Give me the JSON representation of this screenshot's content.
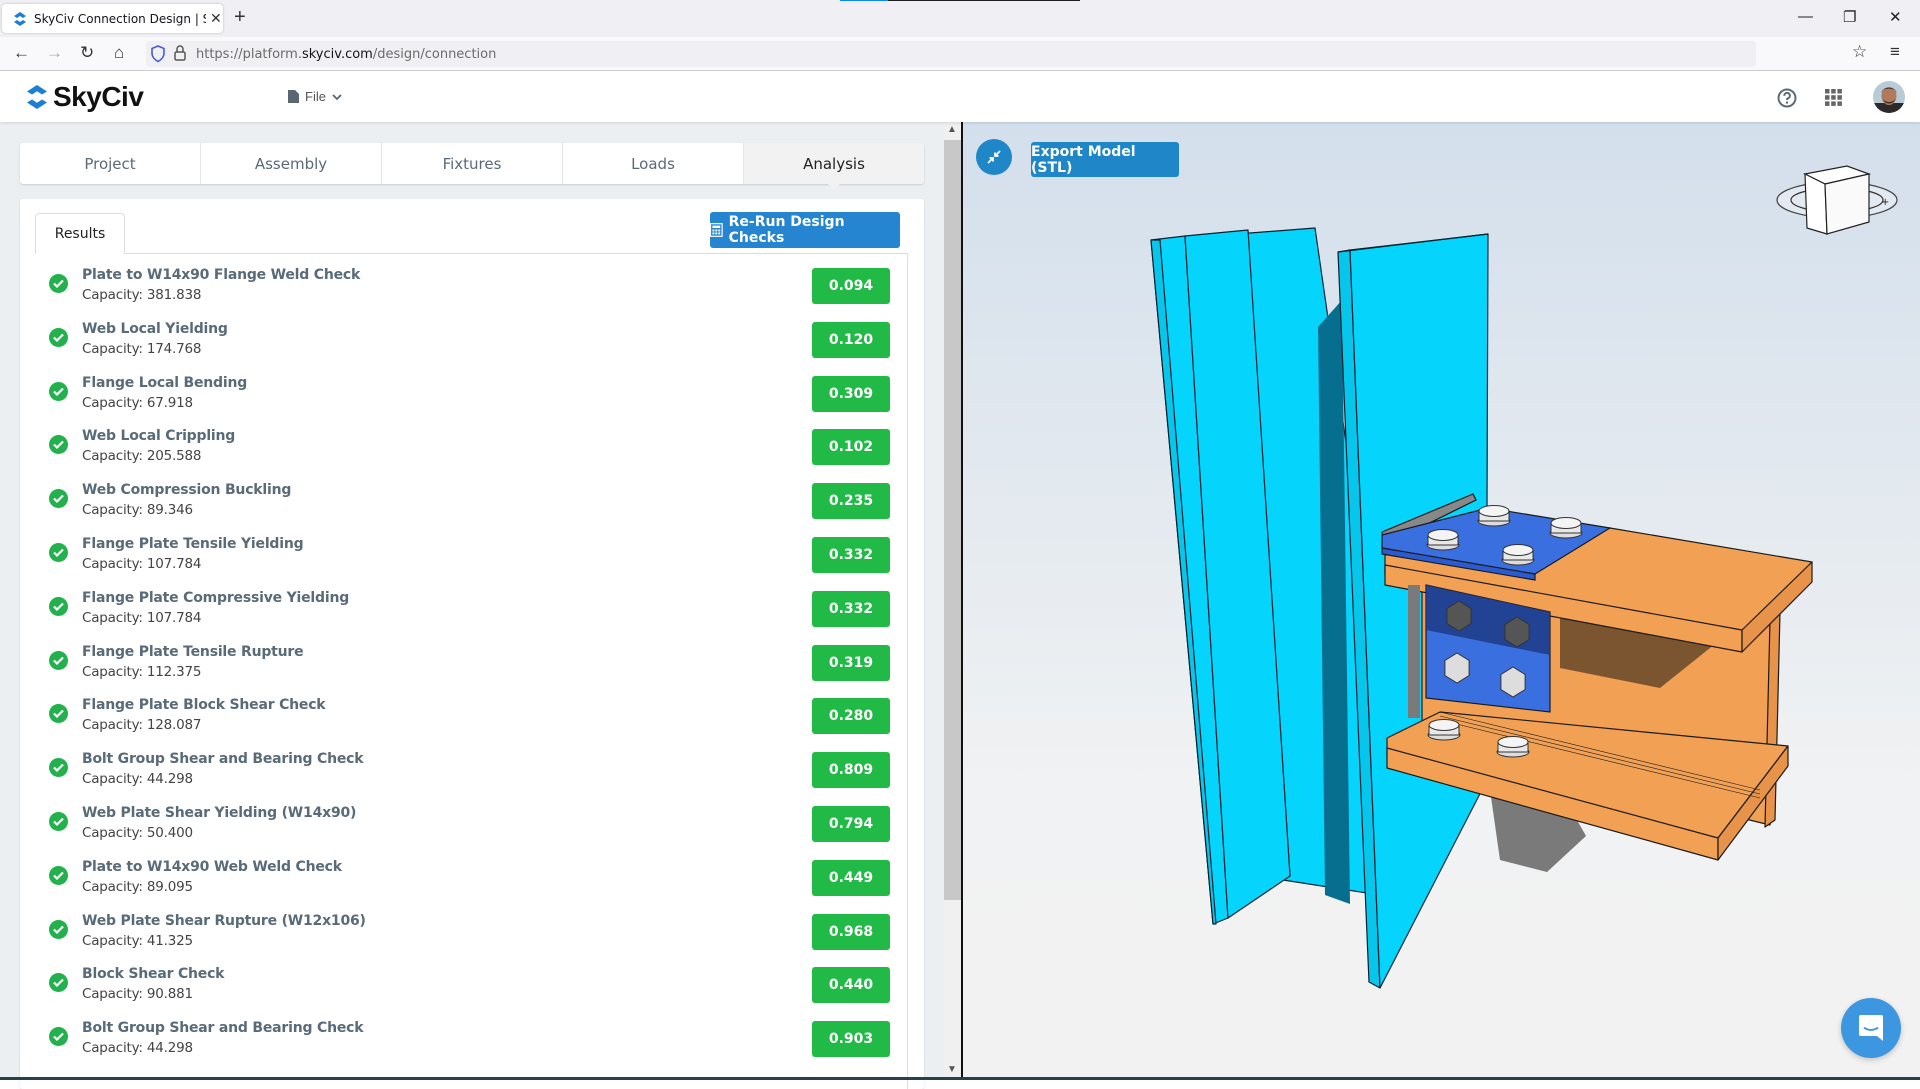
{
  "browser": {
    "tab_title": "SkyCiv Connection Design | SkyCiv",
    "new_tab": "+",
    "close_tab": "✕",
    "url_prefix": "https://platform.",
    "url_domain": "skyciv.com",
    "url_path": "/design/connection",
    "window_controls": {
      "minimize": "—",
      "restore": "❐",
      "close": "✕"
    }
  },
  "header": {
    "brand": "SkyCiv",
    "file_menu": "File",
    "icons": [
      "help-icon",
      "apps-grid-icon",
      "user-avatar"
    ]
  },
  "steps": [
    {
      "label": "Project",
      "active": false
    },
    {
      "label": "Assembly",
      "active": false
    },
    {
      "label": "Fixtures",
      "active": false
    },
    {
      "label": "Loads",
      "active": false
    },
    {
      "label": "Analysis",
      "active": true
    }
  ],
  "results_panel": {
    "tab_label": "Results",
    "rerun_label": "Re-Run Design Checks",
    "capacity_prefix": "Capacity: ",
    "checks": [
      {
        "title": "Plate to W14x90 Flange Weld Check",
        "capacity": "381.838",
        "ratio": "0.094",
        "status": "pass"
      },
      {
        "title": "Web Local Yielding",
        "capacity": "174.768",
        "ratio": "0.120",
        "status": "pass"
      },
      {
        "title": "Flange Local Bending",
        "capacity": "67.918",
        "ratio": "0.309",
        "status": "pass"
      },
      {
        "title": "Web Local Crippling",
        "capacity": "205.588",
        "ratio": "0.102",
        "status": "pass"
      },
      {
        "title": "Web Compression Buckling",
        "capacity": "89.346",
        "ratio": "0.235",
        "status": "pass"
      },
      {
        "title": "Flange Plate Tensile Yielding",
        "capacity": "107.784",
        "ratio": "0.332",
        "status": "pass"
      },
      {
        "title": "Flange Plate Compressive Yielding",
        "capacity": "107.784",
        "ratio": "0.332",
        "status": "pass"
      },
      {
        "title": "Flange Plate Tensile Rupture",
        "capacity": "112.375",
        "ratio": "0.319",
        "status": "pass"
      },
      {
        "title": "Flange Plate Block Shear Check",
        "capacity": "128.087",
        "ratio": "0.280",
        "status": "pass"
      },
      {
        "title": "Bolt Group Shear and Bearing Check",
        "capacity": "44.298",
        "ratio": "0.809",
        "status": "pass"
      },
      {
        "title": "Web Plate Shear Yielding (W14x90)",
        "capacity": "50.400",
        "ratio": "0.794",
        "status": "pass"
      },
      {
        "title": "Plate to W14x90 Web Weld Check",
        "capacity": "89.095",
        "ratio": "0.449",
        "status": "pass"
      },
      {
        "title": "Web Plate Shear Rupture (W12x106)",
        "capacity": "41.325",
        "ratio": "0.968",
        "status": "pass"
      },
      {
        "title": "Block Shear Check",
        "capacity": "90.881",
        "ratio": "0.440",
        "status": "pass"
      },
      {
        "title": "Bolt Group Shear and Bearing Check",
        "capacity": "44.298",
        "ratio": "0.903",
        "status": "pass"
      }
    ]
  },
  "viewer": {
    "export_label": "Export Model (STL)",
    "collapse_icon": "collapse-arrows-icon",
    "navcube_icon": "view-cube-icon",
    "chat_icon": "chat-bubble-icon"
  },
  "colors": {
    "brand_blue": "#2585d0",
    "pass_green": "#22ba47",
    "column_cyan": "#05d4fd",
    "beam_orange": "#f2a154",
    "plate_blue": "#3a6fe0"
  }
}
